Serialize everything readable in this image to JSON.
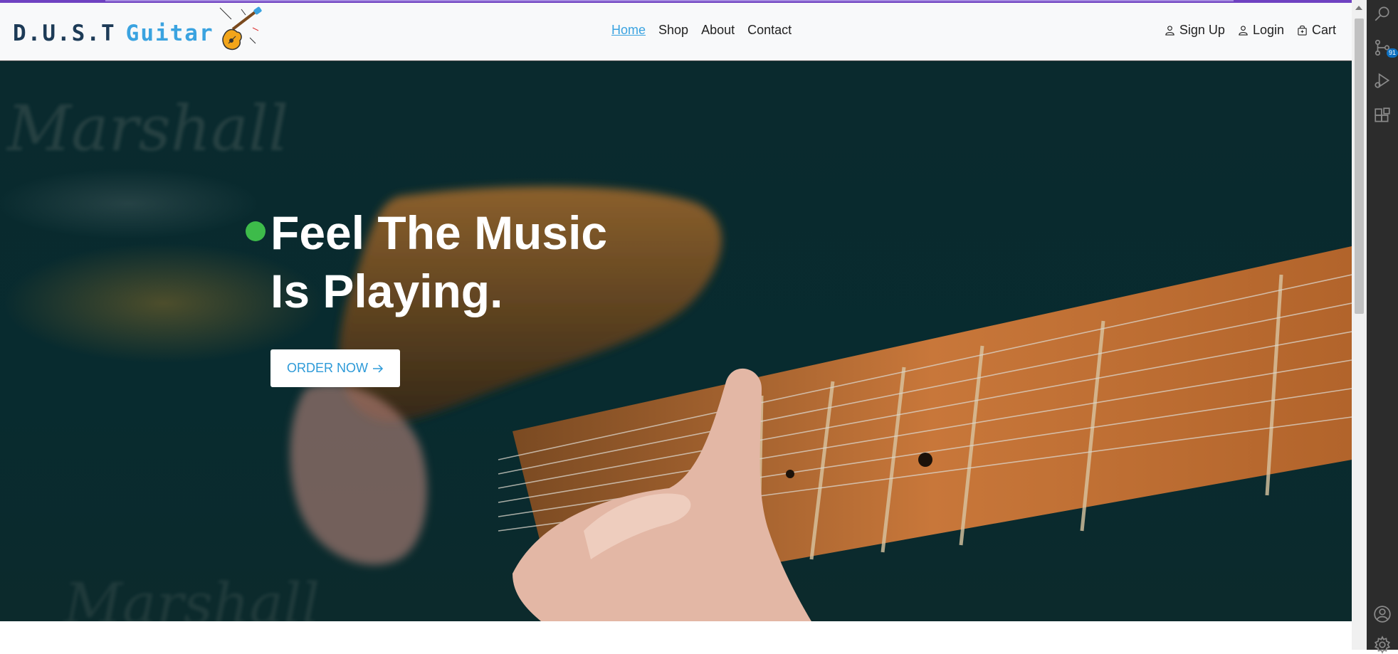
{
  "brand": {
    "word1": "D.U.S.T",
    "word2": "Guitar",
    "logo_icon": "electric-guitar-icon"
  },
  "nav": {
    "links": [
      {
        "label": "Home",
        "active": true
      },
      {
        "label": "Shop",
        "active": false
      },
      {
        "label": "About",
        "active": false
      },
      {
        "label": "Contact",
        "active": false
      }
    ],
    "right": [
      {
        "label": "Sign Up",
        "icon": "user-icon"
      },
      {
        "label": "Login",
        "icon": "user-icon"
      },
      {
        "label": "Cart",
        "icon": "shopping-bag-icon"
      }
    ]
  },
  "hero": {
    "title_line1": "Feel The Music",
    "title_line2": "Is Playing.",
    "button_label": "ORDER NOW",
    "button_icon": "arrow-right-icon"
  },
  "activity_bar": {
    "icons": [
      "search-icon",
      "source-control-icon",
      "run-debug-icon",
      "extensions-icon",
      "account-icon",
      "settings-gear-icon"
    ],
    "source_control_badge": "91"
  },
  "colors": {
    "accent": "#3aa3e0",
    "brand_dark": "#1d3b57",
    "hero_bg": "#082b2f",
    "dot": "#3dbb4a",
    "topbar": "#6f42c1"
  }
}
